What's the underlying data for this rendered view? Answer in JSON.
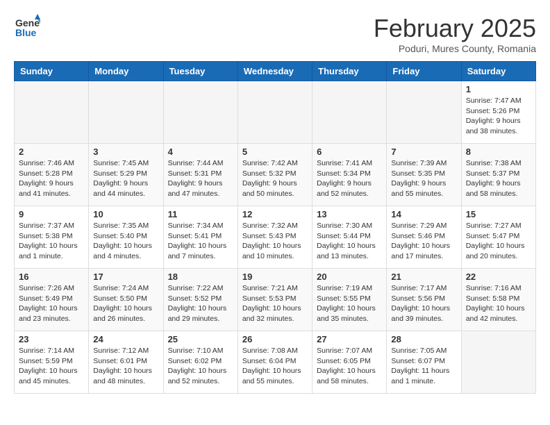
{
  "logo": {
    "general": "General",
    "blue": "Blue"
  },
  "title": "February 2025",
  "subtitle": "Poduri, Mures County, Romania",
  "weekdays": [
    "Sunday",
    "Monday",
    "Tuesday",
    "Wednesday",
    "Thursday",
    "Friday",
    "Saturday"
  ],
  "weeks": [
    [
      {
        "day": "",
        "info": ""
      },
      {
        "day": "",
        "info": ""
      },
      {
        "day": "",
        "info": ""
      },
      {
        "day": "",
        "info": ""
      },
      {
        "day": "",
        "info": ""
      },
      {
        "day": "",
        "info": ""
      },
      {
        "day": "1",
        "info": "Sunrise: 7:47 AM\nSunset: 5:26 PM\nDaylight: 9 hours and 38 minutes."
      }
    ],
    [
      {
        "day": "2",
        "info": "Sunrise: 7:46 AM\nSunset: 5:28 PM\nDaylight: 9 hours and 41 minutes."
      },
      {
        "day": "3",
        "info": "Sunrise: 7:45 AM\nSunset: 5:29 PM\nDaylight: 9 hours and 44 minutes."
      },
      {
        "day": "4",
        "info": "Sunrise: 7:44 AM\nSunset: 5:31 PM\nDaylight: 9 hours and 47 minutes."
      },
      {
        "day": "5",
        "info": "Sunrise: 7:42 AM\nSunset: 5:32 PM\nDaylight: 9 hours and 50 minutes."
      },
      {
        "day": "6",
        "info": "Sunrise: 7:41 AM\nSunset: 5:34 PM\nDaylight: 9 hours and 52 minutes."
      },
      {
        "day": "7",
        "info": "Sunrise: 7:39 AM\nSunset: 5:35 PM\nDaylight: 9 hours and 55 minutes."
      },
      {
        "day": "8",
        "info": "Sunrise: 7:38 AM\nSunset: 5:37 PM\nDaylight: 9 hours and 58 minutes."
      }
    ],
    [
      {
        "day": "9",
        "info": "Sunrise: 7:37 AM\nSunset: 5:38 PM\nDaylight: 10 hours and 1 minute."
      },
      {
        "day": "10",
        "info": "Sunrise: 7:35 AM\nSunset: 5:40 PM\nDaylight: 10 hours and 4 minutes."
      },
      {
        "day": "11",
        "info": "Sunrise: 7:34 AM\nSunset: 5:41 PM\nDaylight: 10 hours and 7 minutes."
      },
      {
        "day": "12",
        "info": "Sunrise: 7:32 AM\nSunset: 5:43 PM\nDaylight: 10 hours and 10 minutes."
      },
      {
        "day": "13",
        "info": "Sunrise: 7:30 AM\nSunset: 5:44 PM\nDaylight: 10 hours and 13 minutes."
      },
      {
        "day": "14",
        "info": "Sunrise: 7:29 AM\nSunset: 5:46 PM\nDaylight: 10 hours and 17 minutes."
      },
      {
        "day": "15",
        "info": "Sunrise: 7:27 AM\nSunset: 5:47 PM\nDaylight: 10 hours and 20 minutes."
      }
    ],
    [
      {
        "day": "16",
        "info": "Sunrise: 7:26 AM\nSunset: 5:49 PM\nDaylight: 10 hours and 23 minutes."
      },
      {
        "day": "17",
        "info": "Sunrise: 7:24 AM\nSunset: 5:50 PM\nDaylight: 10 hours and 26 minutes."
      },
      {
        "day": "18",
        "info": "Sunrise: 7:22 AM\nSunset: 5:52 PM\nDaylight: 10 hours and 29 minutes."
      },
      {
        "day": "19",
        "info": "Sunrise: 7:21 AM\nSunset: 5:53 PM\nDaylight: 10 hours and 32 minutes."
      },
      {
        "day": "20",
        "info": "Sunrise: 7:19 AM\nSunset: 5:55 PM\nDaylight: 10 hours and 35 minutes."
      },
      {
        "day": "21",
        "info": "Sunrise: 7:17 AM\nSunset: 5:56 PM\nDaylight: 10 hours and 39 minutes."
      },
      {
        "day": "22",
        "info": "Sunrise: 7:16 AM\nSunset: 5:58 PM\nDaylight: 10 hours and 42 minutes."
      }
    ],
    [
      {
        "day": "23",
        "info": "Sunrise: 7:14 AM\nSunset: 5:59 PM\nDaylight: 10 hours and 45 minutes."
      },
      {
        "day": "24",
        "info": "Sunrise: 7:12 AM\nSunset: 6:01 PM\nDaylight: 10 hours and 48 minutes."
      },
      {
        "day": "25",
        "info": "Sunrise: 7:10 AM\nSunset: 6:02 PM\nDaylight: 10 hours and 52 minutes."
      },
      {
        "day": "26",
        "info": "Sunrise: 7:08 AM\nSunset: 6:04 PM\nDaylight: 10 hours and 55 minutes."
      },
      {
        "day": "27",
        "info": "Sunrise: 7:07 AM\nSunset: 6:05 PM\nDaylight: 10 hours and 58 minutes."
      },
      {
        "day": "28",
        "info": "Sunrise: 7:05 AM\nSunset: 6:07 PM\nDaylight: 11 hours and 1 minute."
      },
      {
        "day": "",
        "info": ""
      }
    ]
  ]
}
